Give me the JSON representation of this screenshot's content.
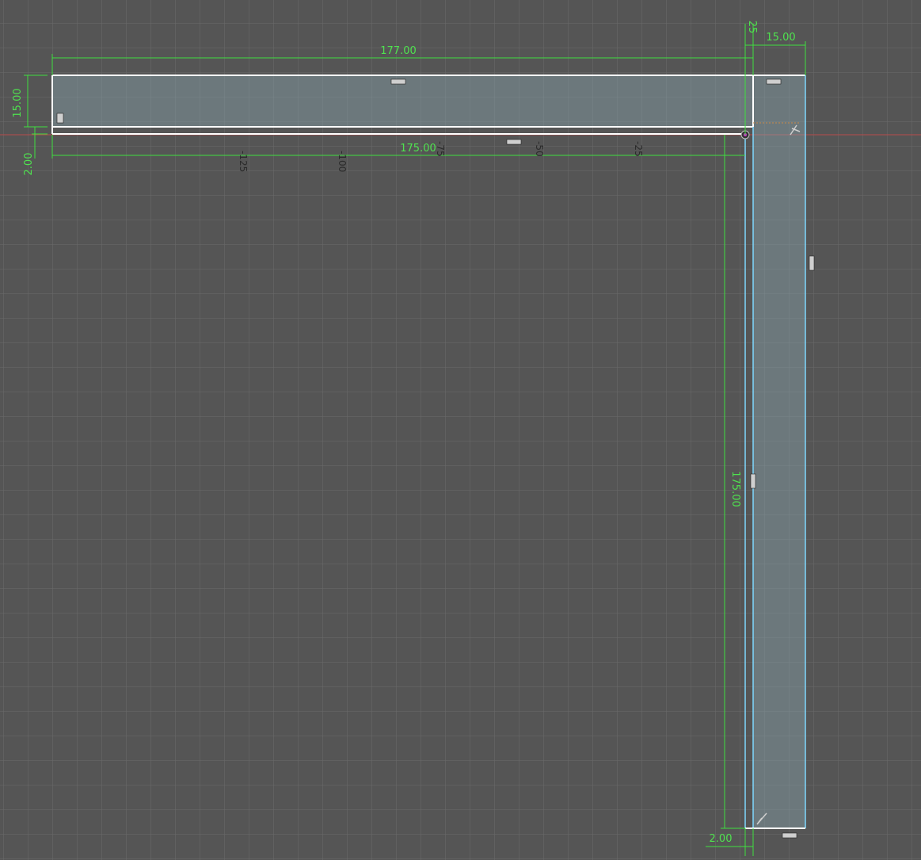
{
  "colors": {
    "background": "#555555",
    "grid_minor": "#6a6a6a",
    "grid_major": "#777777",
    "dimension": "#3ee03e",
    "profile_fill": "#8aa3ad",
    "edge_selected": "#ffffff",
    "edge_construction": "#7fd8ff",
    "axis_x": "#d04040",
    "origin": "#b040c0"
  },
  "dimensions": {
    "top_length": "177.00",
    "inner_length": "175.00",
    "left_height": "15.00",
    "left_gap": "2.00",
    "right_width": "15.00",
    "right_gap_top": "25",
    "vertical_length": "175.00",
    "bottom_gap": "2.00"
  },
  "axis_ticks": [
    "-125",
    "-100",
    "-75",
    "-50",
    "-25"
  ],
  "constraint_icons": [
    "horizontal-constraint-icon",
    "vertical-constraint-icon",
    "perpendicular-constraint-icon",
    "origin-point-icon"
  ]
}
